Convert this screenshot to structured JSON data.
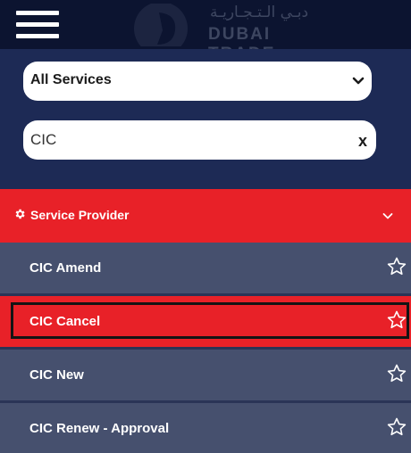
{
  "header": {
    "logo_text_ar": "دبـي الـتـجـاريـة",
    "logo_text_en": "DUBAI TRADE"
  },
  "filters": {
    "service_select_value": "All Services",
    "search_value": "CIC",
    "clear_label": "x"
  },
  "category": {
    "label": "Service Provider"
  },
  "services": [
    {
      "label": "CIC Amend",
      "selected": false
    },
    {
      "label": "CIC Cancel",
      "selected": true
    },
    {
      "label": "CIC New",
      "selected": false
    },
    {
      "label": "CIC Renew - Approval",
      "selected": false
    }
  ],
  "colors": {
    "accent_red": "#e82128",
    "navy": "#1d2a55",
    "item_gray": "#46506e"
  }
}
